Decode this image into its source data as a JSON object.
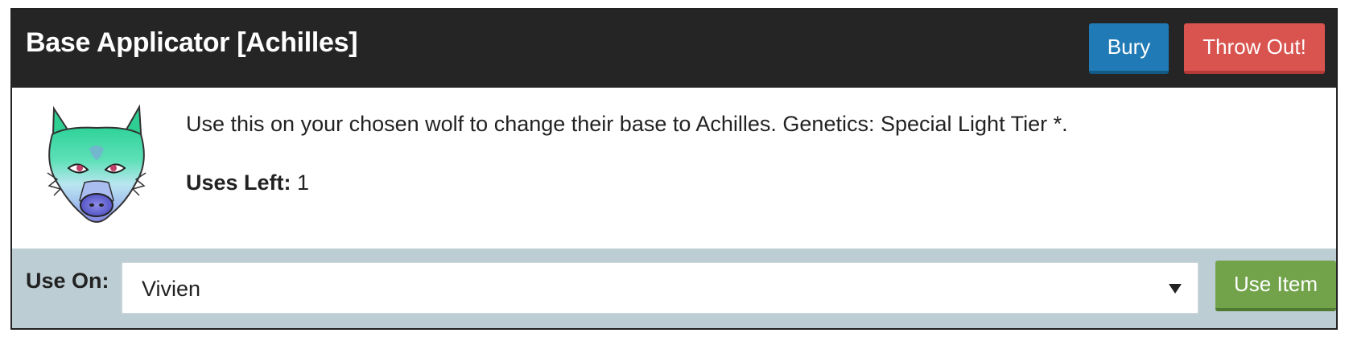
{
  "item": {
    "title": "Base Applicator [Achilles]",
    "description": "Use this on your chosen wolf to change their base to Achilles. Genetics: Special Light Tier *.",
    "uses_left_label": "Uses Left:",
    "uses_left_value": "1",
    "image_icon": "wolf-head-icon"
  },
  "actions": {
    "bury_label": "Bury",
    "throw_out_label": "Throw Out!",
    "use_item_label": "Use Item"
  },
  "use_on": {
    "label": "Use On:",
    "selected": "Vivien"
  },
  "colors": {
    "header_bg": "#252525",
    "bury": "#1f7ab5",
    "throw_out": "#d9534f",
    "use_item": "#72a34b",
    "footer_bg": "#bccdd4"
  }
}
